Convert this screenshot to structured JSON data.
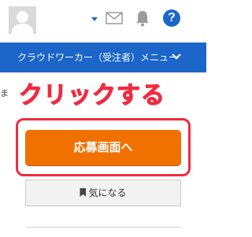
{
  "header": {
    "icons": [
      "avatar",
      "caret-down-icon",
      "mail-icon",
      "bell-icon",
      "help-icon"
    ],
    "help_label": "?"
  },
  "menu": {
    "label": "クラウドワーカー（受注者）メニュー"
  },
  "annotation": {
    "text": "クリックする",
    "color": "#ef2b40"
  },
  "left_edge_text": "ま",
  "apply_button": {
    "label": "応募画面へ",
    "color": "#f07000"
  },
  "bookmark_button": {
    "label": "気になる"
  },
  "colors": {
    "primary": "#1c66c9",
    "accent": "#f07000",
    "highlight": "#ef2b40"
  }
}
